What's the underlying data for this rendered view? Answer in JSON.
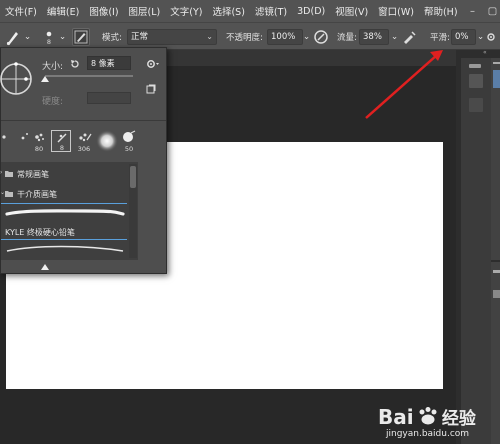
{
  "menu": {
    "items": [
      "文件(F)",
      "编辑(E)",
      "图像(I)",
      "图层(L)",
      "文字(Y)",
      "选择(S)",
      "滤镜(T)",
      "3D(D)",
      "视图(V)",
      "窗口(W)",
      "帮助(H)"
    ],
    "window_controls": [
      "–",
      "▢",
      "✕"
    ]
  },
  "options_bar": {
    "brush_size_value": "8",
    "mode_label": "模式:",
    "mode_value": "正常",
    "opacity_label": "不透明度:",
    "opacity_value": "100%",
    "flow_label": "流量:",
    "flow_value": "38%",
    "smoothing_label": "平滑:",
    "smoothing_value": "0%"
  },
  "brush_panel": {
    "size_label": "大小:",
    "size_value": "8 像素",
    "hardness_label": "硬度:",
    "presets": [
      "",
      "",
      "80",
      "8",
      "306",
      "50"
    ],
    "groups": [
      "常规画笔",
      "干介质画笔"
    ],
    "item_label": "KYLE 终极硬心铅笔"
  },
  "watermark": {
    "brand": "Bai",
    "brand_cn": "经验",
    "url": "jingyan.baidu.com"
  },
  "colors": {
    "menubar": "#535353",
    "canvas_bg": "#282828",
    "arrow": "#e02020",
    "accent": "#5aa0dc"
  }
}
